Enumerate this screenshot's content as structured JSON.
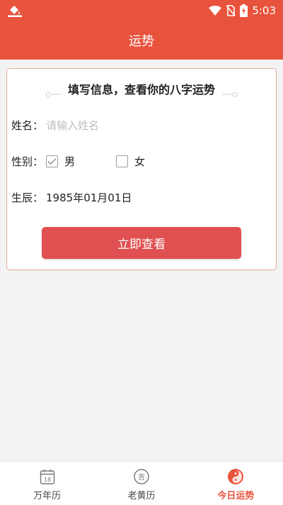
{
  "status_bar": {
    "time": "5:03"
  },
  "app_bar": {
    "title": "运势"
  },
  "form": {
    "title": "填写信息，查看你的八字运势",
    "name_label": "姓名：",
    "name_value": "",
    "name_placeholder": "请输入姓名",
    "gender_label": "性别：",
    "gender_options": [
      {
        "label": "男",
        "checked": true
      },
      {
        "label": "女",
        "checked": false
      }
    ],
    "birth_label": "生辰：",
    "birth_value": "1985年01月01日",
    "submit_label": "立即查看"
  },
  "bottom_nav": {
    "items": [
      {
        "label": "万年历",
        "icon": "calendar-icon",
        "icon_text": "18",
        "active": false
      },
      {
        "label": "老黄历",
        "icon": "almanac-icon",
        "icon_text": "吉",
        "active": false
      },
      {
        "label": "今日运势",
        "icon": "yin-yang-icon",
        "active": true
      }
    ]
  },
  "colors": {
    "accent": "#e8533d",
    "button": "#e05050",
    "card_border": "#e8a9a0"
  }
}
